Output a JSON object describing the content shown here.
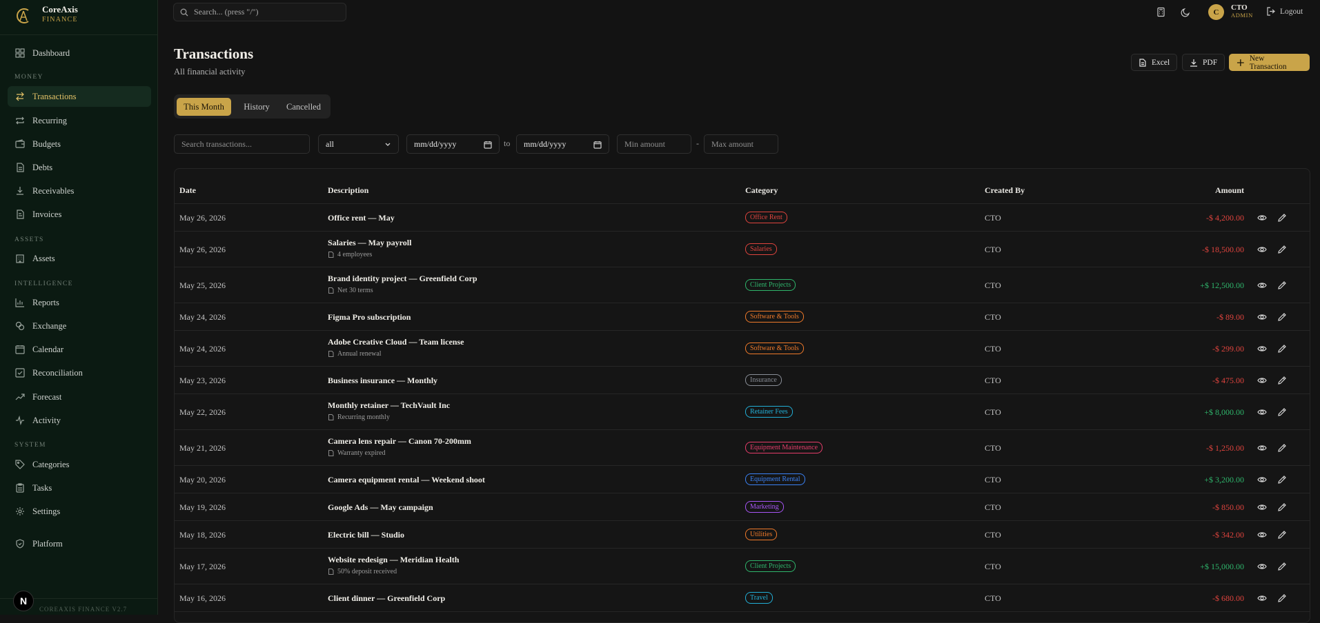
{
  "brand": {
    "name": "CoreAxis",
    "subtitle": "FINANCE"
  },
  "sidebar": {
    "dashboard": "Dashboard",
    "sections": {
      "money": "MONEY",
      "assets": "ASSETS",
      "intelligence": "INTELLIGENCE",
      "system": "SYSTEM"
    },
    "items": [
      {
        "label": "Transactions",
        "icon": "arrows-swap-icon",
        "active": true
      },
      {
        "label": "Recurring",
        "icon": "repeat-icon"
      },
      {
        "label": "Budgets",
        "icon": "wallet-icon"
      },
      {
        "label": "Debts",
        "icon": "file-icon"
      },
      {
        "label": "Receivables",
        "icon": "download-icon"
      },
      {
        "label": "Invoices",
        "icon": "invoice-icon"
      },
      {
        "label": "Assets",
        "icon": "building-icon"
      },
      {
        "label": "Reports",
        "icon": "bar-chart-icon"
      },
      {
        "label": "Exchange",
        "icon": "coins-icon"
      },
      {
        "label": "Calendar",
        "icon": "calendar-icon"
      },
      {
        "label": "Reconciliation",
        "icon": "check-square-icon"
      },
      {
        "label": "Forecast",
        "icon": "trending-up-icon"
      },
      {
        "label": "Activity",
        "icon": "activity-icon"
      },
      {
        "label": "Categories",
        "icon": "tags-icon"
      },
      {
        "label": "Tasks",
        "icon": "clipboard-icon"
      },
      {
        "label": "Settings",
        "icon": "gear-icon"
      },
      {
        "label": "Platform",
        "icon": "shield-icon"
      }
    ],
    "footer": "COREAXIS FINANCE V2.7",
    "badge": "N"
  },
  "topbar": {
    "search_placeholder": "Search... (press \"/\")",
    "avatar_initial": "C",
    "user_name": "CTO",
    "user_role": "ADMIN",
    "logout": "Logout"
  },
  "header": {
    "title": "Transactions",
    "subtitle": "All financial activity",
    "excel": "Excel",
    "pdf": "PDF",
    "new": "New Transaction"
  },
  "tabs": [
    "This Month",
    "History",
    "Cancelled"
  ],
  "filters": {
    "search_placeholder": "Search transactions...",
    "type_value": "all",
    "date_from": "mm/dd/yyyy",
    "to_label": "to",
    "date_to": "mm/dd/yyyy",
    "min_placeholder": "Min amount",
    "dash": "-",
    "max_placeholder": "Max amount"
  },
  "table": {
    "headers": {
      "date": "Date",
      "description": "Description",
      "category": "Category",
      "created_by": "Created By",
      "amount": "Amount"
    },
    "rows": [
      {
        "date": "May 26, 2026",
        "description": "Office rent — May",
        "note": "",
        "category": "Office Rent",
        "tag_color": "#e0443e",
        "created_by": "CTO",
        "amount": "-$ 4,200.00",
        "sign": "neg"
      },
      {
        "date": "May 26, 2026",
        "description": "Salaries — May payroll",
        "note": "4 employees",
        "category": "Salaries",
        "tag_color": "#e0443e",
        "created_by": "CTO",
        "amount": "-$ 18,500.00",
        "sign": "neg"
      },
      {
        "date": "May 25, 2026",
        "description": "Brand identity project — Greenfield Corp",
        "note": "Net 30 terms",
        "category": "Client Projects",
        "tag_color": "#2fb66c",
        "created_by": "CTO",
        "amount": "+$ 12,500.00",
        "sign": "pos"
      },
      {
        "date": "May 24, 2026",
        "description": "Figma Pro subscription",
        "note": "",
        "category": "Software & Tools",
        "tag_color": "#f07a2a",
        "created_by": "CTO",
        "amount": "-$ 89.00",
        "sign": "neg"
      },
      {
        "date": "May 24, 2026",
        "description": "Adobe Creative Cloud — Team license",
        "note": "Annual renewal",
        "category": "Software & Tools",
        "tag_color": "#f07a2a",
        "created_by": "CTO",
        "amount": "-$ 299.00",
        "sign": "neg"
      },
      {
        "date": "May 23, 2026",
        "description": "Business insurance — Monthly",
        "note": "",
        "category": "Insurance",
        "tag_color": "#8a8f98",
        "created_by": "CTO",
        "amount": "-$ 475.00",
        "sign": "neg"
      },
      {
        "date": "May 22, 2026",
        "description": "Monthly retainer — TechVault Inc",
        "note": "Recurring monthly",
        "category": "Retainer Fees",
        "tag_color": "#22b0d8",
        "created_by": "CTO",
        "amount": "+$ 8,000.00",
        "sign": "pos"
      },
      {
        "date": "May 21, 2026",
        "description": "Camera lens repair — Canon 70-200mm",
        "note": "Warranty expired",
        "category": "Equipment Maintenance",
        "tag_color": "#e63d6b",
        "created_by": "CTO",
        "amount": "-$ 1,250.00",
        "sign": "neg"
      },
      {
        "date": "May 20, 2026",
        "description": "Camera equipment rental — Weekend shoot",
        "note": "",
        "category": "Equipment Rental",
        "tag_color": "#3b82f6",
        "created_by": "CTO",
        "amount": "+$ 3,200.00",
        "sign": "pos"
      },
      {
        "date": "May 19, 2026",
        "description": "Google Ads — May campaign",
        "note": "",
        "category": "Marketing",
        "tag_color": "#a855f7",
        "created_by": "CTO",
        "amount": "-$ 850.00",
        "sign": "neg"
      },
      {
        "date": "May 18, 2026",
        "description": "Electric bill — Studio",
        "note": "",
        "category": "Utilities",
        "tag_color": "#f07a2a",
        "created_by": "CTO",
        "amount": "-$ 342.00",
        "sign": "neg"
      },
      {
        "date": "May 17, 2026",
        "description": "Website redesign — Meridian Health",
        "note": "50% deposit received",
        "category": "Client Projects",
        "tag_color": "#2fb66c",
        "created_by": "CTO",
        "amount": "+$ 15,000.00",
        "sign": "pos"
      },
      {
        "date": "May 16, 2026",
        "description": "Client dinner — Greenfield Corp",
        "note": "",
        "category": "Travel",
        "tag_color": "#22b0d8",
        "created_by": "CTO",
        "amount": "-$ 680.00",
        "sign": "neg"
      }
    ]
  },
  "colors": {
    "accent": "#c9a449",
    "sidebar_bg": "#0b1a12",
    "negative": "#e0443e",
    "positive": "#2fb66c"
  }
}
